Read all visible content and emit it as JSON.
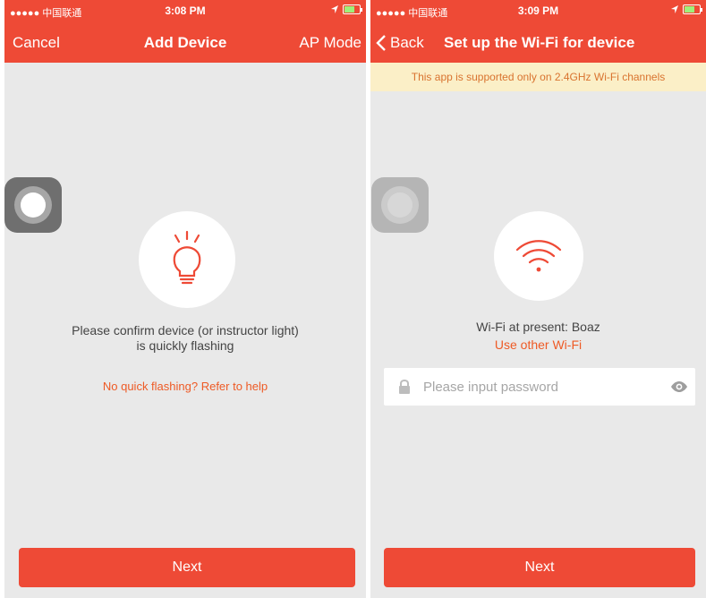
{
  "colors": {
    "accent": "#ee4a36",
    "link": "#ee5a25",
    "banner_bg": "#fbefc7",
    "banner_text": "#d9732f",
    "background": "#e9e9e9"
  },
  "screen1": {
    "status": {
      "carrier": "●●●●● 中国联通",
      "time": "3:08 PM"
    },
    "nav": {
      "left": "Cancel",
      "title": "Add Device",
      "right": "AP Mode"
    },
    "icon": "lightbulb-icon",
    "message_line1": "Please confirm device (or instructor light)",
    "message_line2": "is quickly flashing",
    "help_link": "No quick flashing? Refer to help",
    "next_label": "Next"
  },
  "screen2": {
    "status": {
      "carrier": "●●●●● 中国联通",
      "time": "3:09 PM"
    },
    "nav": {
      "back": "Back",
      "title": "Set up the Wi-Fi for device"
    },
    "banner": "This app is supported only on 2.4GHz Wi-Fi channels",
    "icon": "wifi-icon",
    "wifi_present": "Wi-Fi at present: Boaz",
    "other_wifi_link": "Use other Wi-Fi",
    "password_placeholder": "Please input password",
    "next_label": "Next"
  }
}
